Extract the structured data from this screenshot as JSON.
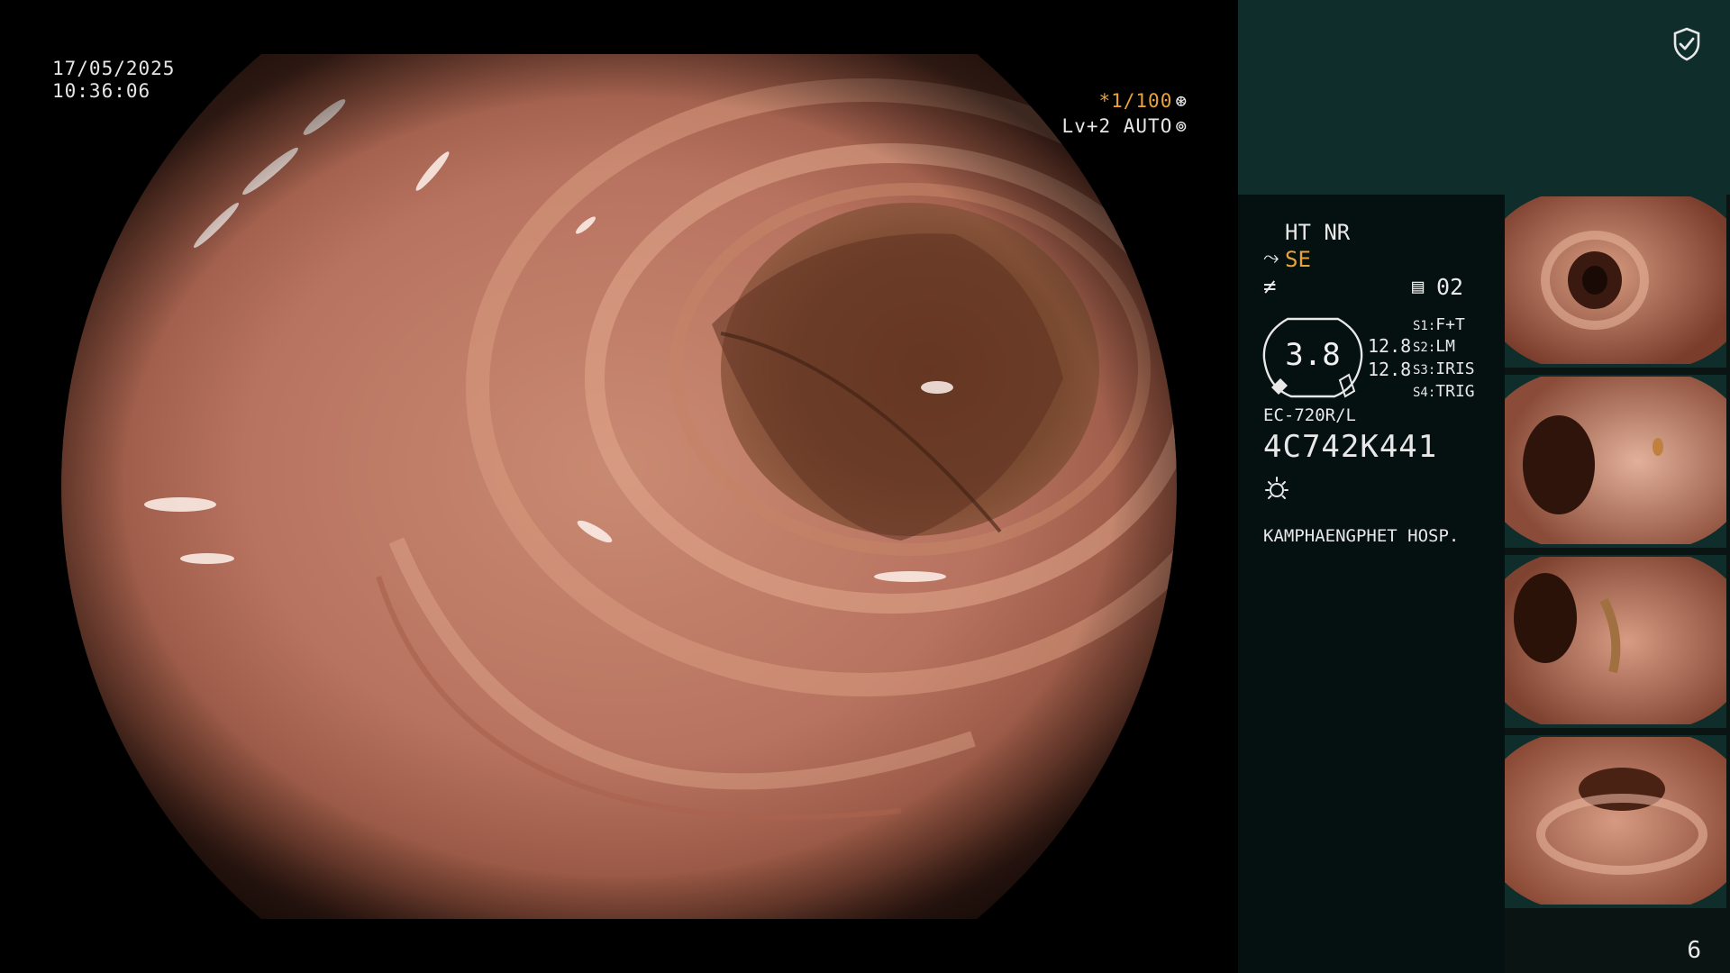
{
  "overlay": {
    "date": "17/05/2025",
    "time": "10:36:06",
    "shutter": "*1/100",
    "shutter_icon": "aperture-icon",
    "level": "Lv+2 AUTO",
    "level_icon": "iris-icon"
  },
  "panel": {
    "mode": "HT NR",
    "structure": "SE",
    "channel_icon": "memory-card-icon",
    "channel": "02",
    "gauge_value": "3.8",
    "gauge_side_1": "12.8",
    "gauge_side_2": "12.8",
    "switches": [
      {
        "key": "S1:",
        "value": "F+T"
      },
      {
        "key": "S2:",
        "value": "LM"
      },
      {
        "key": "S3:",
        "value": "IRIS"
      },
      {
        "key": "S4:",
        "value": "TRIG"
      }
    ],
    "scope_model": "EC-720R/L",
    "scope_serial": "4C742K441",
    "hospital": "KAMPHAENGPHET HOSP.",
    "page_number": "6"
  },
  "colors": {
    "accent_orange": "#e8a33a",
    "panel_teal": "#0f2d2b",
    "panel_dark": "#051010"
  }
}
